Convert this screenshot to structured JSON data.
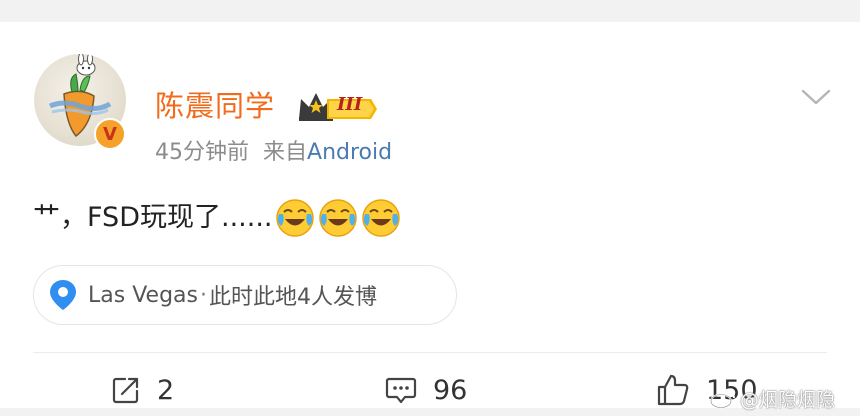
{
  "post": {
    "username": "陈震同学",
    "level_badge": "III",
    "verified_badge": "V",
    "time": "45分钟前",
    "source_prefix": "来自",
    "source_device": "Android",
    "text": "艹，FSD玩现了......",
    "emoji_names": [
      "laugh-cry-emoji",
      "laugh-cry-emoji",
      "laugh-cry-emoji"
    ]
  },
  "location": {
    "place": "Las Vegas",
    "separator": "·",
    "info": "此时此地4人发博"
  },
  "actions": {
    "repost_count": "2",
    "comment_count": "96",
    "like_count": "150"
  },
  "watermark": {
    "text": "@烟隐烟隐"
  },
  "colors": {
    "username": "#f26b1d",
    "device_link": "#4a7bb3",
    "location_pin": "#2f8ef0",
    "badge_orange": "#f6a22a"
  }
}
